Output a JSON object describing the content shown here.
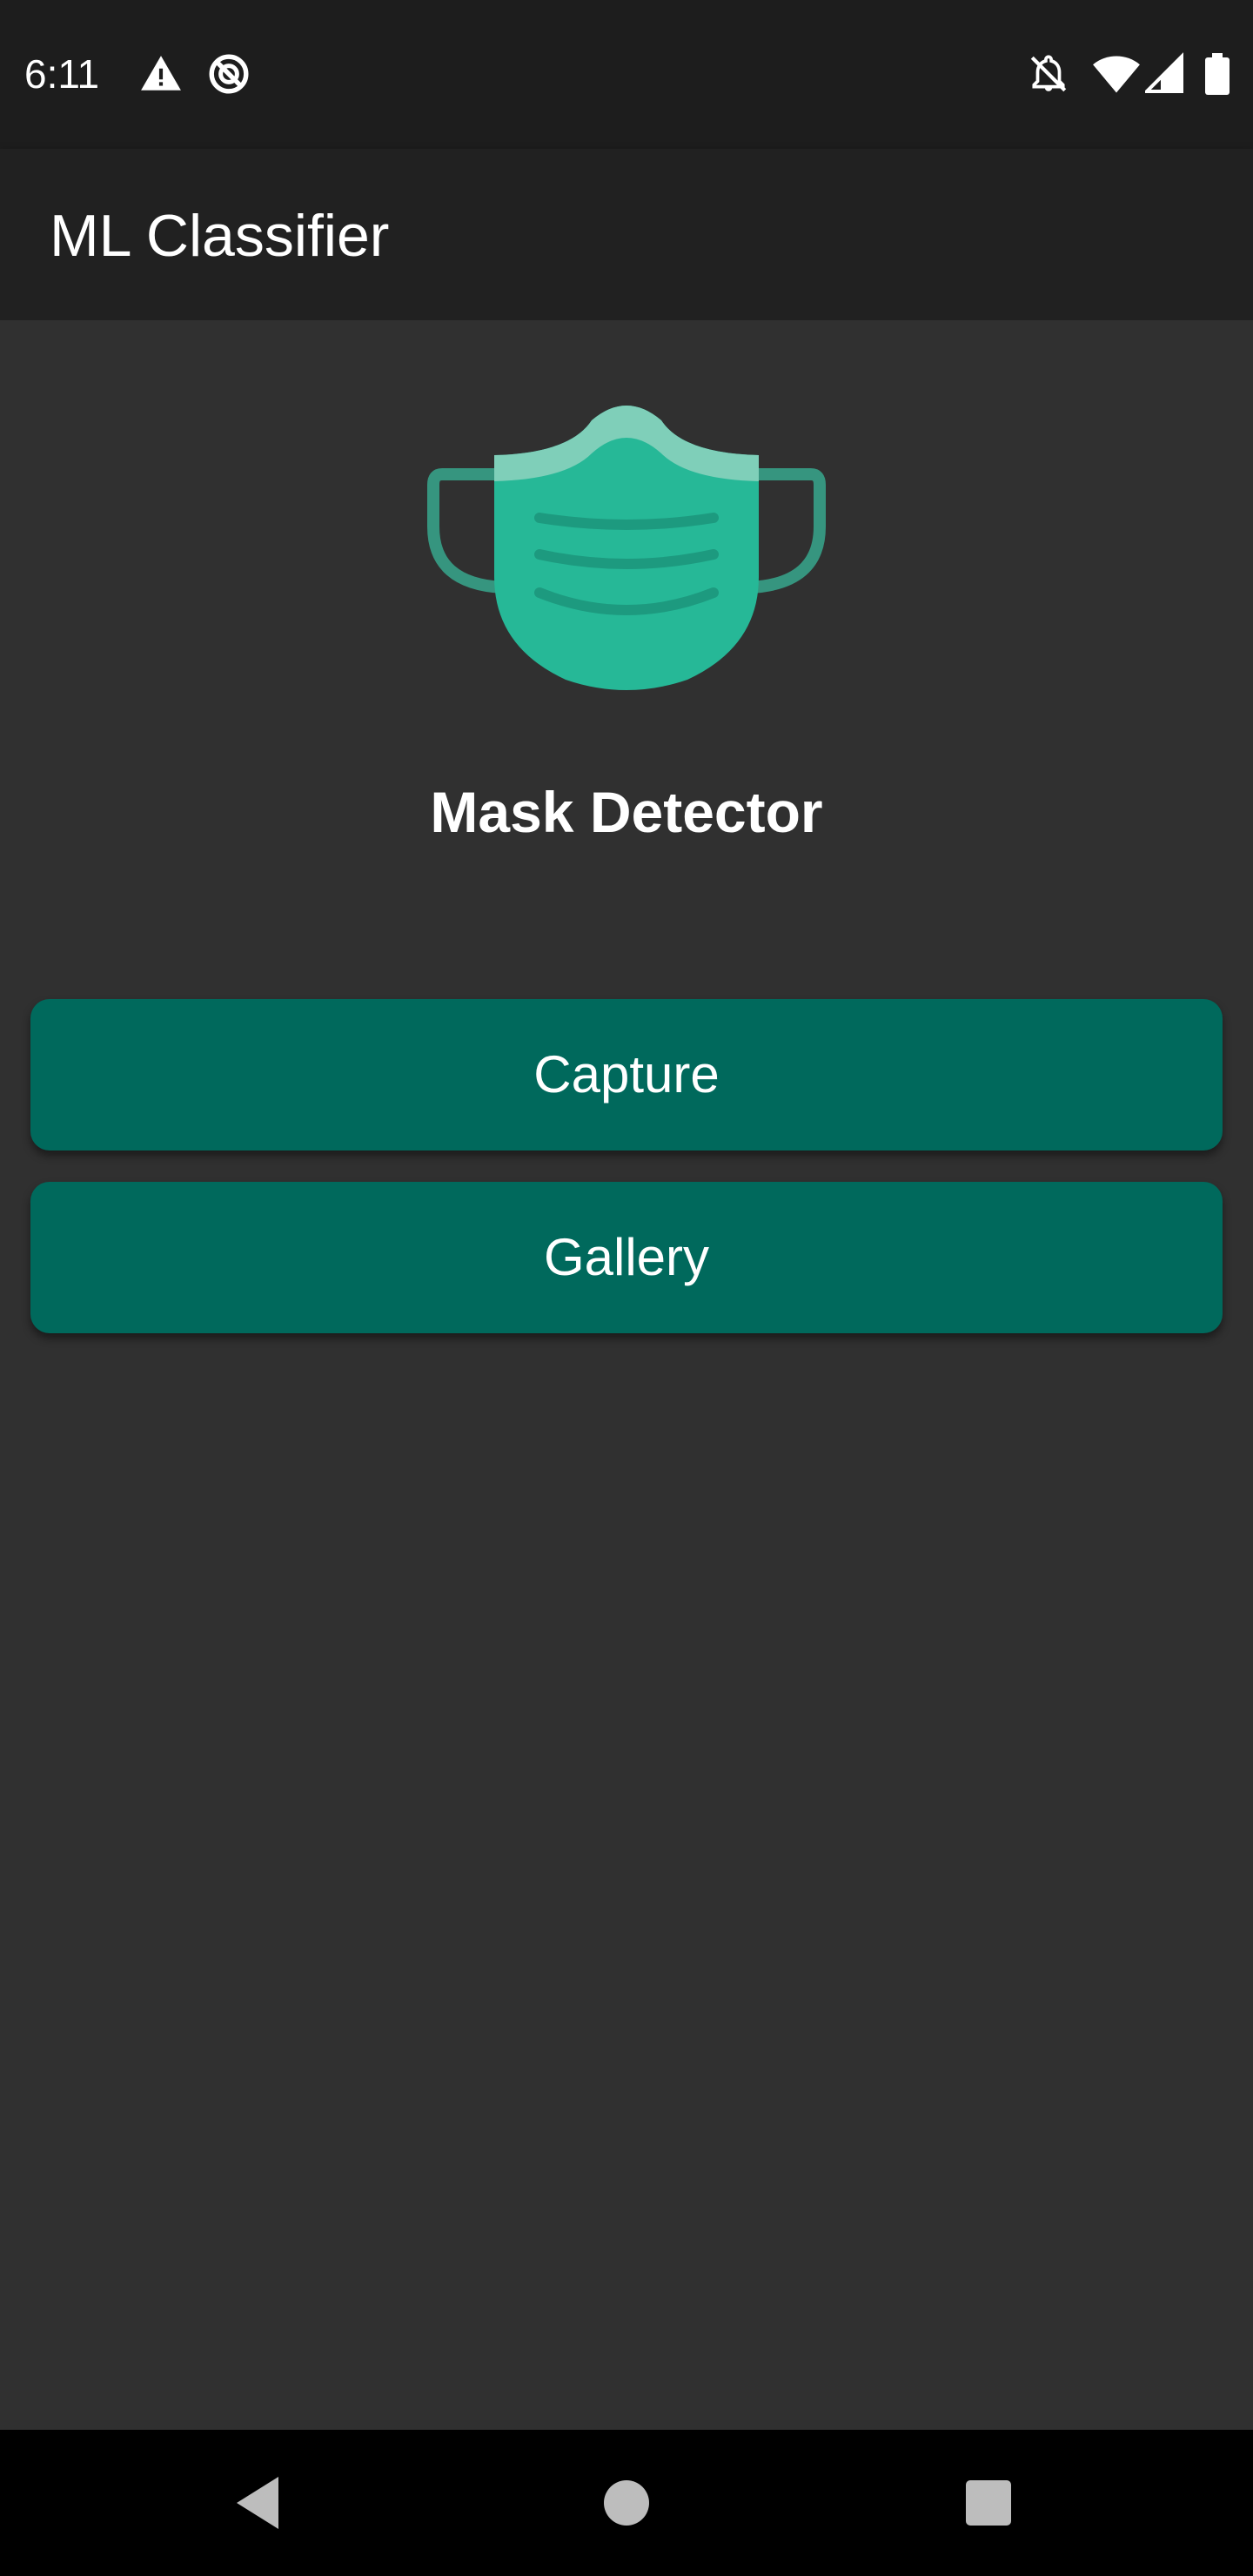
{
  "status_bar": {
    "time": "6:11",
    "left_icons": [
      "warning-icon",
      "no-disturb-circle-icon"
    ],
    "right_icons": [
      "notifications-off-icon",
      "wifi-icon",
      "cell-signal-icon",
      "battery-icon"
    ]
  },
  "app_bar": {
    "title": "ML Classifier"
  },
  "main": {
    "logo_icon": "face-mask-icon",
    "heading": "Mask Detector",
    "buttons": {
      "capture": "Capture",
      "gallery": "Gallery"
    }
  },
  "nav_bar": {
    "icons": [
      "back-icon",
      "home-icon",
      "recents-icon"
    ]
  },
  "colors": {
    "background": "#303030",
    "app_bar": "#212121",
    "status_bar": "#1d1d1d",
    "button": "#00695c",
    "mask_primary": "#26b897",
    "mask_light": "#7fcfb9",
    "mask_strap": "#36957f"
  }
}
